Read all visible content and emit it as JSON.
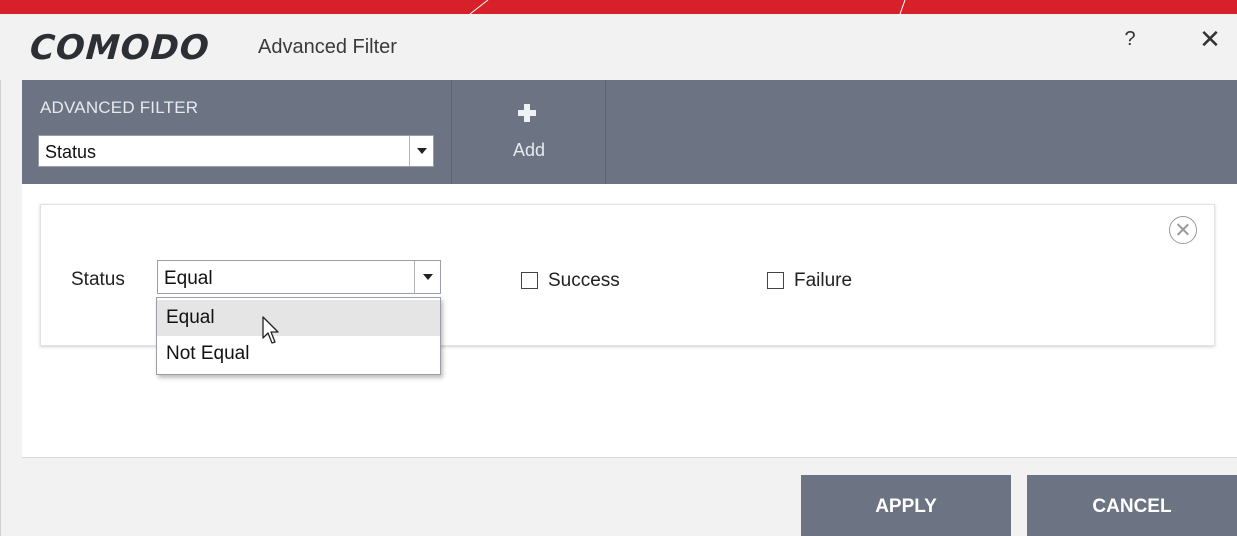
{
  "window": {
    "logo": "COMODO",
    "title": "Advanced Filter",
    "help_label": "?",
    "close_label": "✕"
  },
  "toolbar": {
    "section_label": "ADVANCED FILTER",
    "filter_select_value": "Status",
    "add_label": "Add"
  },
  "filter_row": {
    "field_label": "Status",
    "operator_value": "Equal",
    "options": [
      {
        "label": "Success",
        "checked": false
      },
      {
        "label": "Failure",
        "checked": false
      }
    ]
  },
  "operator_dropdown": {
    "items": [
      "Equal",
      "Not Equal"
    ],
    "hovered_index": 0
  },
  "buttons": {
    "apply": "APPLY",
    "cancel": "CANCEL"
  },
  "colors": {
    "accent_red": "#d8202a",
    "toolbar_gray": "#6c7382"
  }
}
